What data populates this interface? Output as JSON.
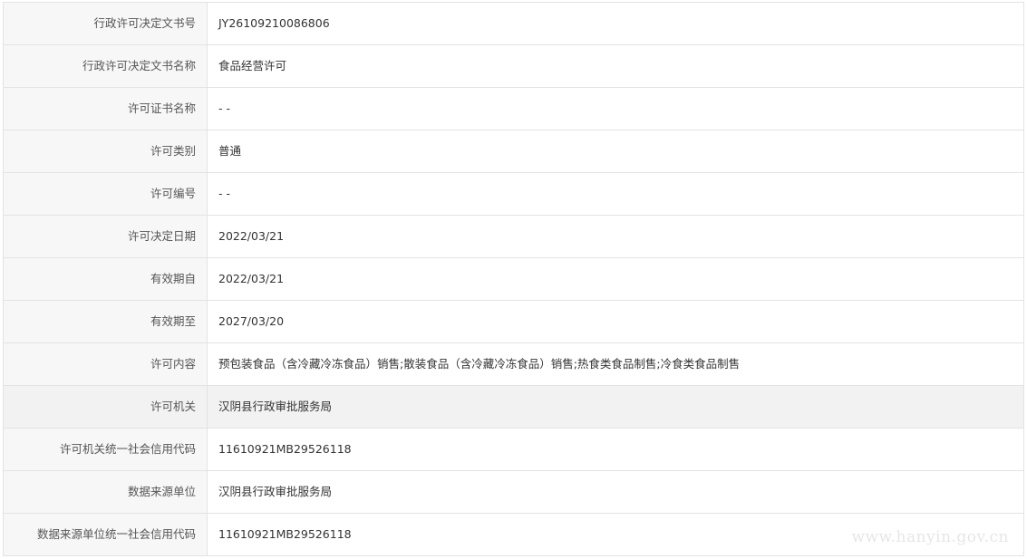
{
  "rows": [
    {
      "label": "行政许可决定文书号",
      "value": "JY26109210086806"
    },
    {
      "label": "行政许可决定文书名称",
      "value": "食品经营许可"
    },
    {
      "label": "许可证书名称",
      "value": "- -"
    },
    {
      "label": "许可类别",
      "value": "普通"
    },
    {
      "label": "许可编号",
      "value": "- -"
    },
    {
      "label": "许可决定日期",
      "value": "2022/03/21"
    },
    {
      "label": "有效期自",
      "value": "2022/03/21"
    },
    {
      "label": "有效期至",
      "value": "2027/03/20"
    },
    {
      "label": "许可内容",
      "value": "预包装食品（含冷藏冷冻食品）销售;散装食品（含冷藏冷冻食品）销售;热食类食品制售;冷食类食品制售"
    },
    {
      "label": "许可机关",
      "value": "汉阴县行政审批服务局"
    },
    {
      "label": "许可机关统一社会信用代码",
      "value": "11610921MB29526118"
    },
    {
      "label": "数据来源单位",
      "value": "汉阴县行政审批服务局"
    },
    {
      "label": "数据来源单位统一社会信用代码",
      "value": "11610921MB29526118"
    }
  ],
  "highlighted_row": "许可机关",
  "watermark": "www.hanyin.gov.cn",
  "colors": {
    "border": "#e3e3e3",
    "label_bg": "#f7f7f7",
    "highlight_bg": "#f2f2f2",
    "label_text": "#555555",
    "value_text": "#333333"
  }
}
